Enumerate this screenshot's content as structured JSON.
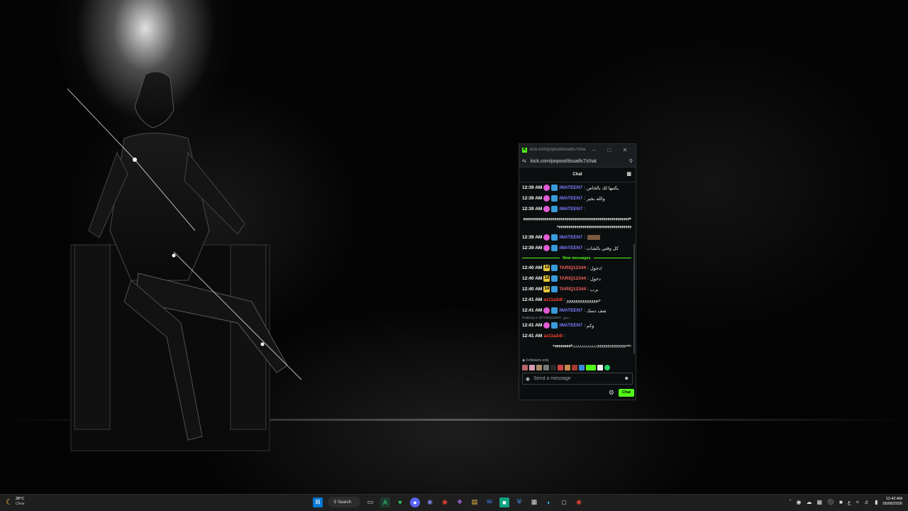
{
  "browser": {
    "tab_title": "kick.com/popout/itssaifx7/cha...",
    "url": "kick.com/popout/itssaifx7/chat"
  },
  "chat": {
    "header": "Chat",
    "new_messages_label": "New messages",
    "reply_label": "Replying to @TARIQ12344: دخول",
    "followers_only": "Followers only",
    "input_placeholder": "Send a message",
    "send_label": "Chat",
    "messages": [
      {
        "time": "12:39 AM",
        "user": "iWATEEN7",
        "text": "يكتبها لك بالخاص"
      },
      {
        "time": "12:39 AM",
        "user": "iWATEEN7",
        "text": "والله بخير"
      },
      {
        "time": "12:39 AM",
        "user": "iWATEEN7",
        "text": "",
        "long": "ههههههههههههههههههههههههههههههههههههههههههههههههههههههههههههههههههههههههههههههههههههههههههههه"
      },
      {
        "time": "12:39 AM",
        "user": "iWATEEN7",
        "text": ""
      },
      {
        "time": "12:39 AM",
        "user": "iWATEEN7",
        "text": "كل وقتي بالشات"
      },
      {
        "time": "12:40 AM",
        "badge": "14",
        "user": "TARIQ12344",
        "text": "دخول!"
      },
      {
        "time": "12:40 AM",
        "badge": "14",
        "user": "TARIQ12344",
        "text": "دخول"
      },
      {
        "time": "12:40 AM",
        "badge": "14",
        "user": "TARIQ12344",
        "text": "برب"
      },
      {
        "time": "12:41 AM",
        "user": "az11a2dl",
        "text": "حوووووووووووووو"
      },
      {
        "time": "12:41 AM",
        "user": "iWATEEN7",
        "text": "شف دسك"
      },
      {
        "time": "12:41 AM",
        "user": "iWATEEN7",
        "text": "وكم"
      },
      {
        "time": "12:41 AM",
        "user": "az11a2dl",
        "text": "",
        "long": "بشووووووووووووووررررررررررررهههههههههه"
      }
    ]
  },
  "taskbar": {
    "temperature": "38°C",
    "condition": "Clear",
    "search_label": "Search",
    "time": "12:42 AM",
    "date": "05/08/2026",
    "lang": "ع"
  },
  "colors": {
    "kick_green": "#53fc18",
    "user_iwateen": "#7c7cff",
    "user_tariq": "#f0605c",
    "user_az": "#ff4433"
  }
}
